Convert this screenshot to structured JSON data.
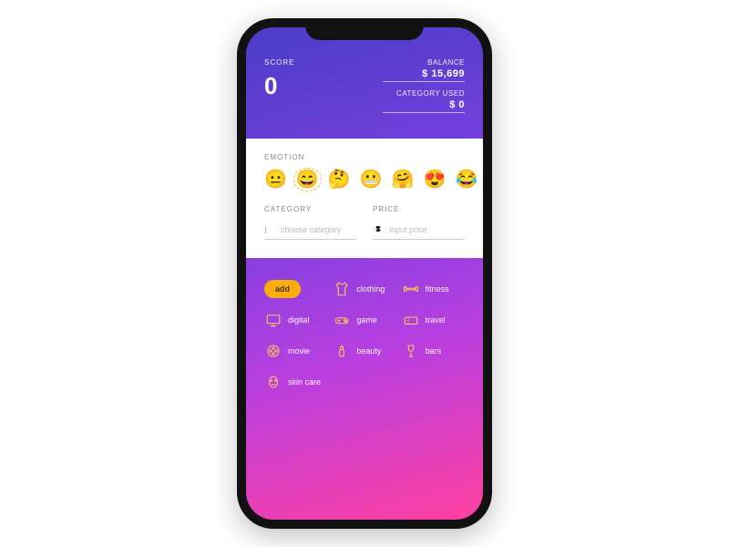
{
  "header": {
    "score_label": "SCORE",
    "score_value": "0",
    "balance_label": "BALANCE",
    "balance_value": "$ 15,699",
    "category_used_label": "CATEGORY USED",
    "category_used_value": "$ 0"
  },
  "card": {
    "emotion_label": "EMOTION",
    "emojis": [
      "😐",
      "😄",
      "🤔",
      "😬",
      "🤗",
      "😍",
      "😂"
    ],
    "category_label": "CATEGORY",
    "price_label": "PRICE",
    "category_placeholder": "choose category",
    "price_placeholder": "input price"
  },
  "categories": {
    "add_label": "add",
    "items": [
      {
        "key": "clothing",
        "label": "clothing"
      },
      {
        "key": "fitness",
        "label": "fitness"
      },
      {
        "key": "digital",
        "label": "digital"
      },
      {
        "key": "game",
        "label": "game"
      },
      {
        "key": "travel",
        "label": "travel"
      },
      {
        "key": "movie",
        "label": "movie"
      },
      {
        "key": "beauty",
        "label": "beauty"
      },
      {
        "key": "bars",
        "label": "bars"
      },
      {
        "key": "skincare",
        "label": "skin care"
      }
    ]
  }
}
